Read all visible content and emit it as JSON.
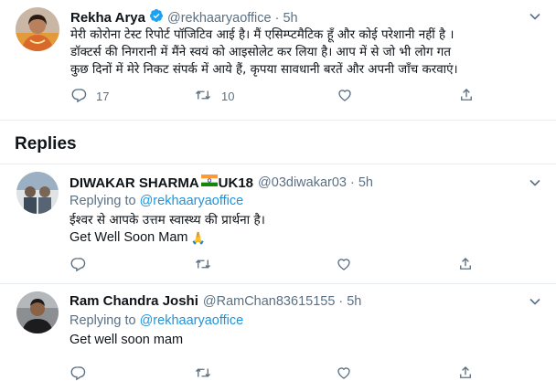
{
  "main_tweet": {
    "author_name": "Rekha Arya",
    "handle": "@rekhaaryaoffice",
    "separator": "·",
    "time": "5h",
    "text_line1": "मेरी कोरोना टेस्ट रिपोर्ट पॉजिटिव आई है। मैं एसिम्प्टमैटिक हूँ और कोई परेशानी नहीं है ।",
    "text_line2": "डॉक्टर्स की निगरानी में मैंने स्वयं को आइसोलेट कर लिया है। आप में से जो भी लोग गत",
    "text_line3": "कुछ दिनों में मेरे निकट संपर्क में आये हैं, कृपया सावधानी बरतें और अपनी जाँच करवाएं।",
    "reply_count": "17",
    "retweet_count": "10",
    "like_count": "",
    "share_label": ""
  },
  "replies_heading": "Replies",
  "replies": [
    {
      "author_name": "DIWAKAR SHARMA",
      "author_suffix": "UK18",
      "handle": "@03diwakar03",
      "separator": "·",
      "time": "5h",
      "replying_prefix": "Replying to",
      "replying_handle": "@rekhaaryaoffice",
      "text_line1": "ईश्वर से आपके उत्तम स्वास्थ्य की प्रार्थना है।",
      "text_line2": "Get Well Soon Mam",
      "emoji": "🙏"
    },
    {
      "author_name": "Ram Chandra Joshi",
      "handle": "@RamChan83615155",
      "separator": "·",
      "time": "5h",
      "replying_prefix": "Replying to",
      "replying_handle": "@rekhaaryaoffice",
      "text_line1": "Get well soon mam"
    }
  ],
  "colors": {
    "accent": "#1b95e0",
    "muted": "#5b7083",
    "verified": "#1da1f2",
    "divider": "#e6ecf0"
  },
  "icons": [
    "verified-badge-icon",
    "chevron-down-icon",
    "reply-icon",
    "retweet-icon",
    "like-icon",
    "share-icon",
    "india-flag-icon",
    "folded-hands-emoji"
  ]
}
